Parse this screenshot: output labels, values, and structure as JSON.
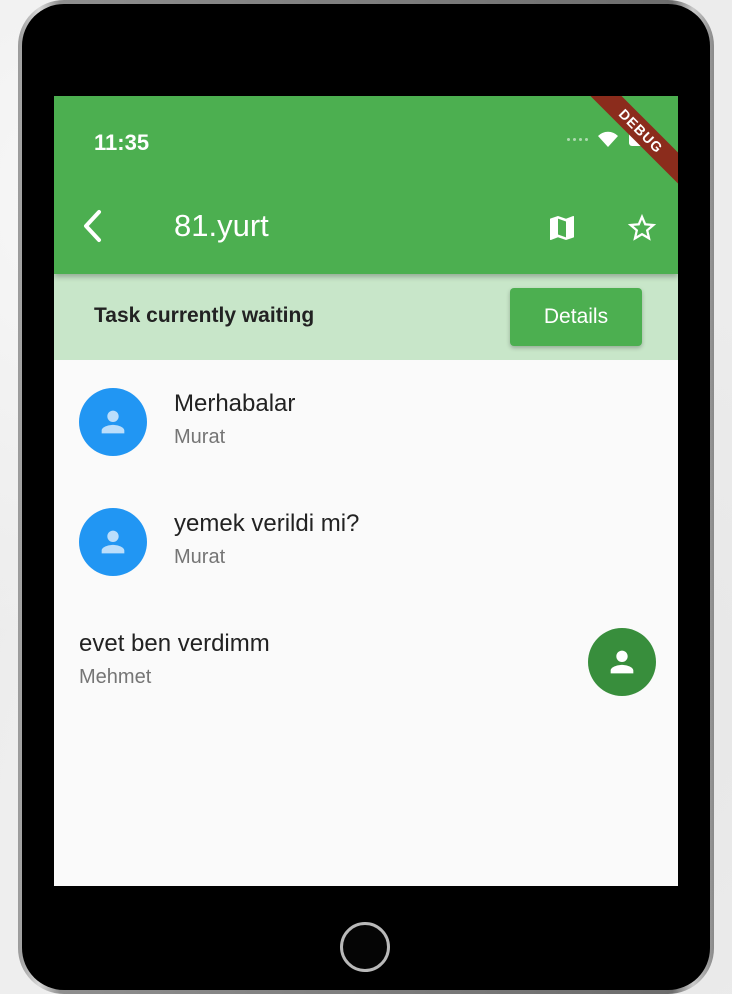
{
  "status_bar": {
    "time": "11:35",
    "debug_banner": "DEBUG"
  },
  "appbar": {
    "title": "81.yurt",
    "back_icon": "chevron-left-icon",
    "map_icon": "map-icon",
    "star_icon": "star-outline-icon",
    "color": "#4caf50"
  },
  "banner": {
    "text": "Task currently waiting",
    "button_label": "Details",
    "color": "#c8e6c9"
  },
  "messages": [
    {
      "text": "Merhabalar",
      "author": "Murat",
      "side": "left",
      "avatar_color": "#2196f3"
    },
    {
      "text": "yemek verildi mi?",
      "author": "Murat",
      "side": "left",
      "avatar_color": "#2196f3"
    },
    {
      "text": "evet ben verdimm",
      "author": "Mehmet",
      "side": "right",
      "avatar_color": "#388e3c"
    }
  ]
}
